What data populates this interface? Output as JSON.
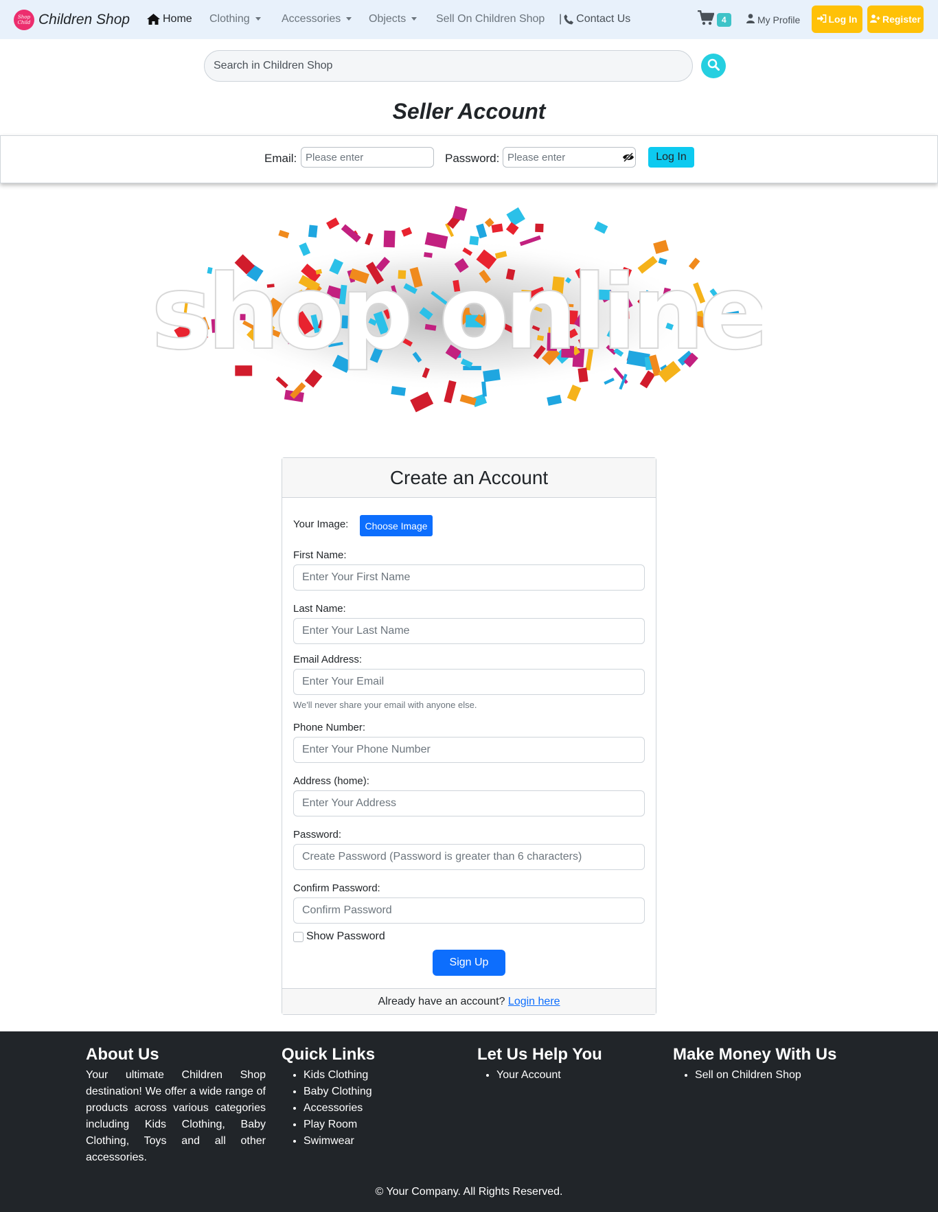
{
  "navbar": {
    "brand_logo_text": "Shop Child",
    "brand": "Children Shop",
    "home": "Home",
    "clothing": "Clothing",
    "accessories": "Accessories",
    "objects": "Objects",
    "sell": "Sell On Children Shop",
    "contact": "Contact Us",
    "contact_separator": "|",
    "cart_count": "4",
    "profile": "My Profile",
    "login": "Log In",
    "register": "Register"
  },
  "search": {
    "placeholder": "Search in Children Shop"
  },
  "seller": {
    "title": "Seller Account",
    "email_label": "Email:",
    "email_placeholder": "Please enter",
    "password_label": "Password:",
    "password_placeholder": "Please enter",
    "login_button": "Log In"
  },
  "hero": {
    "text": "shop online"
  },
  "form": {
    "title": "Create an Account",
    "image_label": "Your Image:",
    "choose_image": "Choose Image",
    "first_name_label": "First Name:",
    "first_name_placeholder": "Enter Your First Name",
    "last_name_label": "Last Name:",
    "last_name_placeholder": "Enter Your Last Name",
    "email_label": "Email Address:",
    "email_placeholder": "Enter Your Email",
    "email_help": "We'll never share your email with anyone else.",
    "phone_label": "Phone Number:",
    "phone_placeholder": "Enter Your Phone Number",
    "address_label": "Address (home):",
    "address_placeholder": "Enter Your Address",
    "password_label": "Password:",
    "password_placeholder": "Create Password (Password is greater than 6 characters)",
    "confirm_label": "Confirm Password:",
    "confirm_placeholder": "Confirm Password",
    "show_password": "Show Password",
    "signup": "Sign Up",
    "footer_text": "Already have an account?",
    "footer_link": "Login here"
  },
  "footer": {
    "about_title": "About Us",
    "about_text": "Your ultimate Children Shop destination! We offer a wide range of products across various categories including Kids Clothing, Baby Clothing, Toys and all other accessories.",
    "links_title": "Quick Links",
    "links": [
      "Kids Clothing",
      "Baby Clothing",
      "Accessories",
      "Play Room",
      "Swimwear"
    ],
    "help_title": "Let Us Help You",
    "help_links": [
      "Your Account"
    ],
    "money_title": "Make Money With Us",
    "money_links": [
      "Sell on Children Shop"
    ],
    "copyright": "© Your Company. All Rights Reserved."
  },
  "colors": {
    "navbar_bg": "#e8f1fb",
    "accent_yellow": "#ffc107",
    "primary_blue": "#0d6efd",
    "info_cyan": "#0dcaf0",
    "search_button": "#25cfe0",
    "cart_badge": "#3ec3c8",
    "footer_bg": "#212529"
  }
}
